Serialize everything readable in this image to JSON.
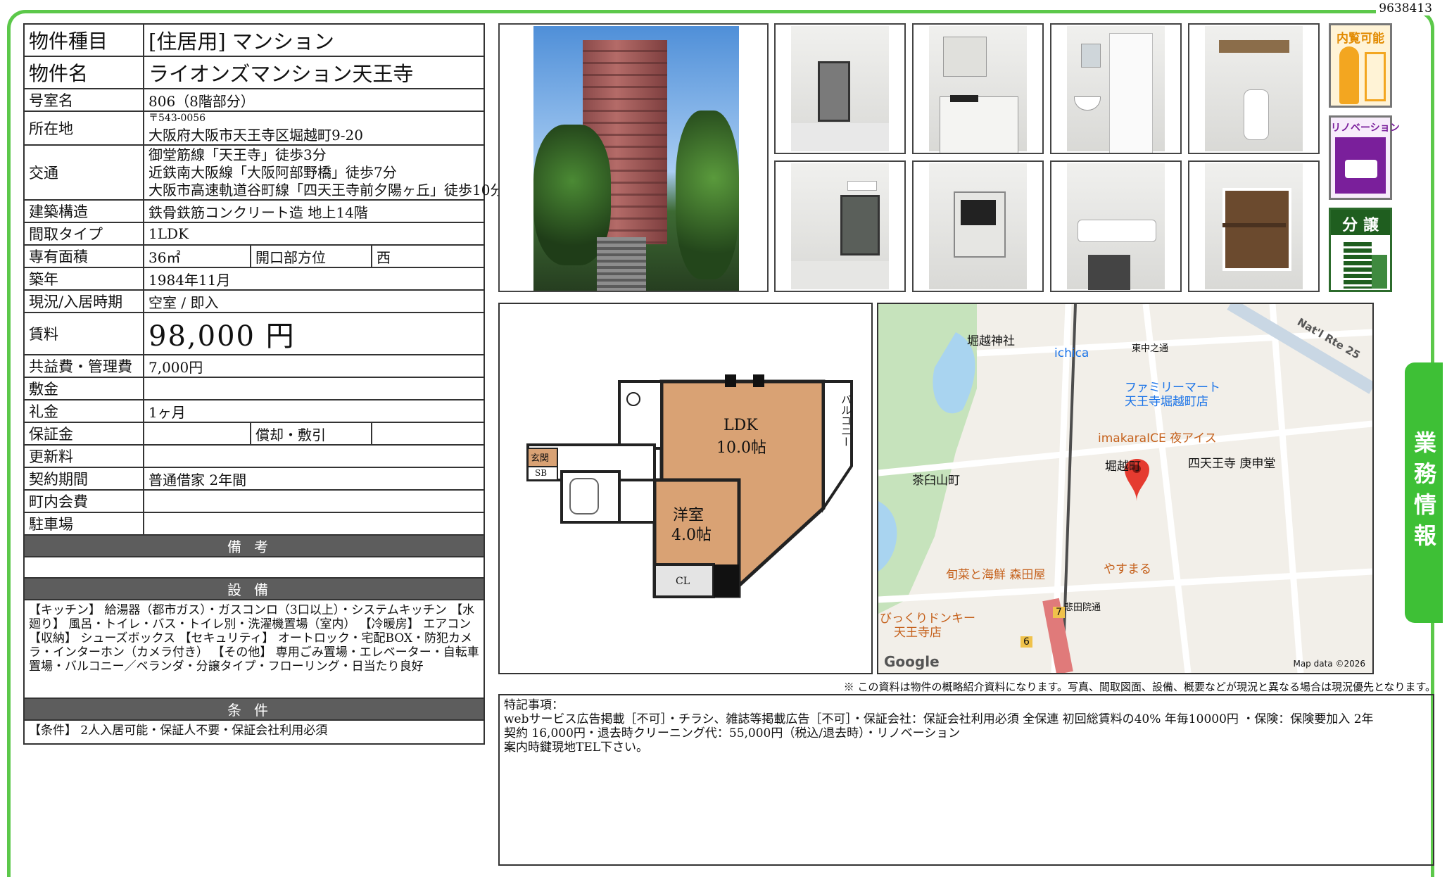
{
  "doc_id": "9638413",
  "spec": {
    "type_label": "物件種目",
    "type_value": "[住居用] マンション",
    "name_label": "物件名",
    "name_value": "ライオンズマンション天王寺",
    "room_label": "号室名",
    "room_value": "806（8階部分）",
    "address_label": "所在地",
    "postal": "〒543-0056",
    "address": "大阪府大阪市天王寺区堀越町9-20",
    "access_label": "交通",
    "access": [
      "御堂筋線「天王寺」徒歩3分",
      "近鉄南大阪線「大阪阿部野橋」徒歩7分",
      "大阪市高速軌道谷町線「四天王寺前夕陽ヶ丘」徒歩10分"
    ],
    "structure_label": "建築構造",
    "structure_value": "鉄骨鉄筋コンクリート造 地上14階",
    "layout_label": "間取タイプ",
    "layout_value": "1LDK",
    "area_label": "専有面積",
    "area_value": "36㎡",
    "direction_label": "開口部方位",
    "direction_value": "西",
    "built_label": "築年",
    "built_value": "1984年11月",
    "status_label": "現況/入居時期",
    "status_value": "空室 / 即入",
    "rent_label": "賃料",
    "rent_value": "98,000 円",
    "fee_label": "共益費・管理費",
    "fee_value": "7,000円",
    "deposit_label": "敷金",
    "deposit_value": "",
    "key_money_label": "礼金",
    "key_money_value": "1ヶ月",
    "guarantee_label": "保証金",
    "guarantee_value": "",
    "amort_label": "償却・敷引",
    "amort_value": "",
    "renewal_label": "更新料",
    "renewal_value": "",
    "contract_label": "契約期間",
    "contract_value": "普通借家 2年間",
    "community_label": "町内会費",
    "community_value": "",
    "parking_label": "駐車場",
    "parking_value": ""
  },
  "sections": {
    "remarks_header": "備考",
    "remarks_body": "",
    "equipment_header": "設備",
    "equipment_body": "【キッチン】 給湯器（都市ガス）・ガスコンロ（3口以上）・システムキッチン 【水廻り】 風呂・トイレ・バス・トイレ別・洗濯機置場（室内） 【冷暖房】 エアコン 【収納】 シューズボックス 【セキュリティ】 オートロック・宅配BOX・防犯カメラ・インターホン（カメラ付き） 【その他】 専用ごみ置場・エレベーター・自転車置場・バルコニー／ベランダ・分譲タイプ・フローリング・日当たり良好",
    "conditions_header": "条件",
    "conditions_body": "【条件】 2人入居可能・保証人不要・保証会社利用必須"
  },
  "badges": {
    "viewing": "内覧可能",
    "renovation": "リノベーション",
    "condo": "分 譲"
  },
  "sidebar_label": "業務情報",
  "floorplan": {
    "ldk_name": "LDK",
    "ldk_size": "10.0帖",
    "western_name": "洋室",
    "western_size": "4.0帖",
    "entrance": "玄関",
    "sb": "SB",
    "cl": "CL",
    "balcony": "バルコニー"
  },
  "map": {
    "labels": [
      "堀越神社",
      "ichica",
      "東中之通",
      "ファミリーマート",
      "天王寺堀越町店",
      "imakaraICE 夜アイス",
      "四天王寺 庚申堂",
      "茶臼山町",
      "堀越町",
      "旬菜と海鮮 森田屋",
      "やすまる",
      "びっくりドンキー",
      "天王寺店",
      "悲田院通",
      "Nat'l Rte 25"
    ],
    "google": "Google",
    "attribution": "Map data ©2026",
    "route_badges": [
      "7",
      "6"
    ]
  },
  "disclaimer": "※ この資料は物件の概略紹介資料になります。写真、間取図面、設備、概要などが現況と異なる場合は現況優先となります。",
  "notes": {
    "title": "特記事項：",
    "line1": "webサービス広告掲載［不可］・チラシ、雑誌等掲載広告［不可］・保証会社：保証会社利用必須 全保連 初回総賃料の40% 年毎10000円 ・保険：保険要加入 2年",
    "line2": "契約 16,000円・退去時クリーニング代：55,000円（税込/退去時）・リノベーション",
    "line3": "案内時鍵現地TEL下さい。"
  }
}
